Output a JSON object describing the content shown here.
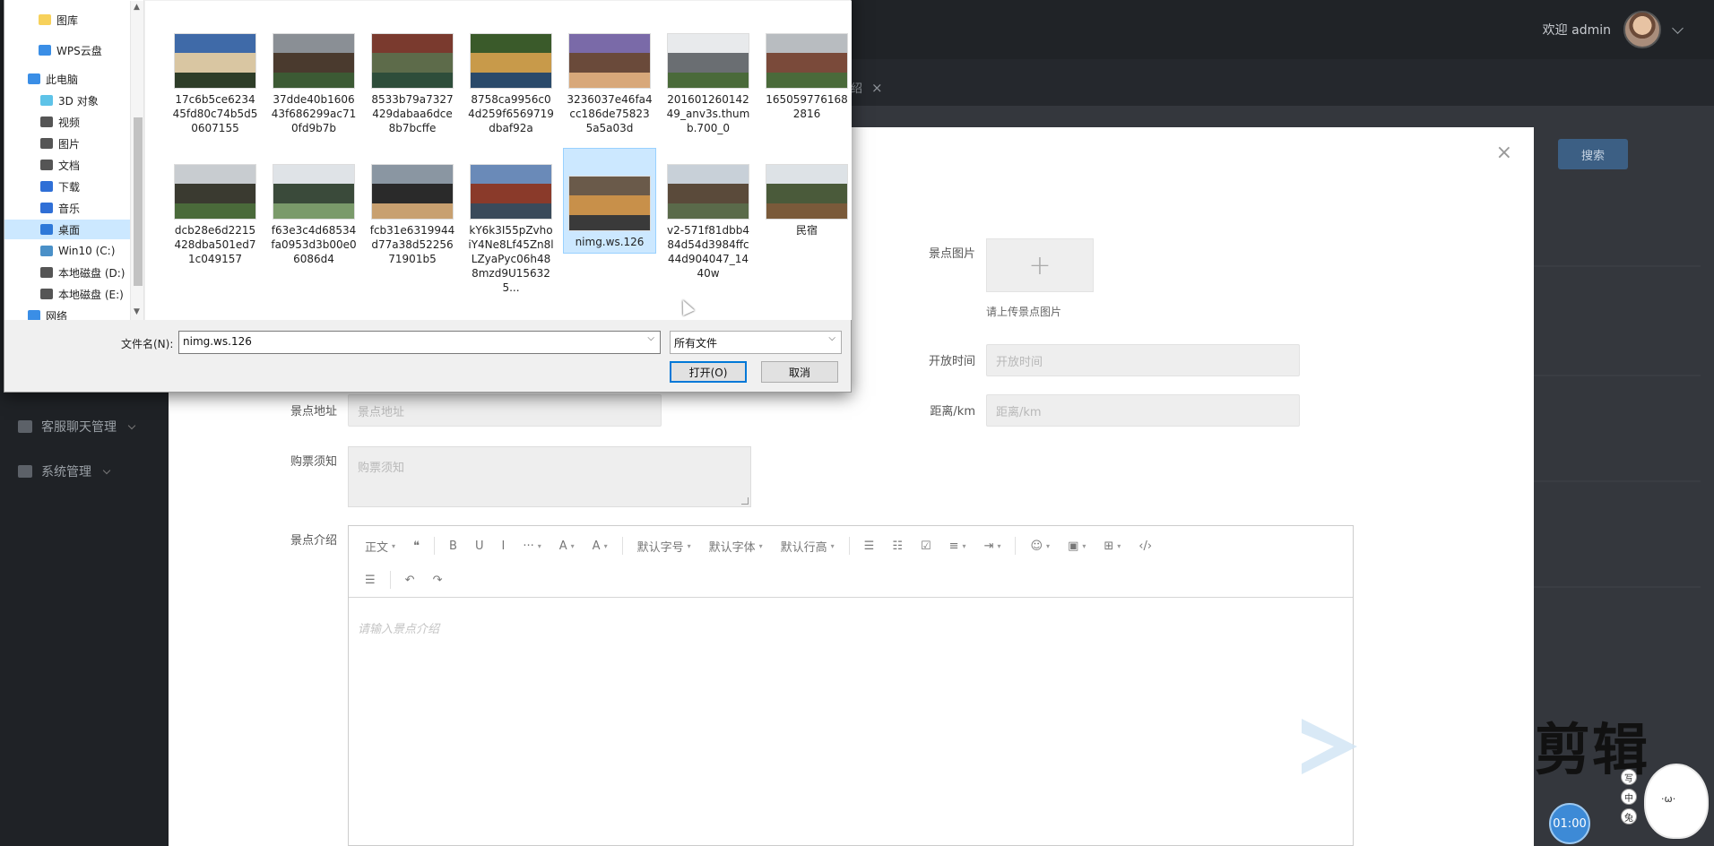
{
  "app": {
    "header": {
      "welcome": "欢迎 admin"
    },
    "tab": {
      "label": "介绍"
    },
    "sidebar": [
      {
        "label": "客服聊天管理"
      },
      {
        "label": "系统管理"
      }
    ],
    "search_button": "搜索"
  },
  "form": {
    "close": "×",
    "image_label": "景点图片",
    "upload_plus": "+",
    "upload_tip": "请上传景点图片",
    "open_time_label": "开放时间",
    "open_time_placeholder": "开放时间",
    "address_label": "景点地址",
    "address_placeholder": "景点地址",
    "distance_label": "距离/km",
    "distance_placeholder": "距离/km",
    "ticket_label": "购票须知",
    "ticket_placeholder": "购票须知",
    "intro_label": "景点介绍",
    "editor": {
      "toolbar_row1": [
        "正文",
        "❝",
        "B",
        "U",
        "I",
        "···",
        "A",
        "A",
        "默认字号",
        "默认字体",
        "默认行高",
        "☰",
        "☷",
        "☑",
        "≡",
        "⇥",
        "☺",
        "▣",
        "⊞",
        "‹/›"
      ],
      "toolbar_row2": [
        "☰",
        "↶",
        "↷"
      ],
      "placeholder": "请输入景点介绍"
    },
    "watermark": "剪辑"
  },
  "overlay": {
    "timer": "01:00",
    "mascot_face": "·ω·",
    "side_tools": [
      "写",
      "中",
      "兔"
    ]
  },
  "dialog": {
    "nav": [
      {
        "label": "图库",
        "icon": "folder-icon",
        "color": "#f7d15b"
      },
      {
        "label": "WPS云盘",
        "icon": "cloud-icon",
        "color": "#3a8ee6"
      },
      {
        "label": "此电脑",
        "icon": "computer-icon",
        "color": "#3a8ee6"
      },
      {
        "label": "3D 对象",
        "icon": "3d-icon",
        "color": "#5ec3e8"
      },
      {
        "label": "视频",
        "icon": "video-icon",
        "color": "#555555"
      },
      {
        "label": "图片",
        "icon": "pictures-icon",
        "color": "#555555"
      },
      {
        "label": "文档",
        "icon": "documents-icon",
        "color": "#555555"
      },
      {
        "label": "下载",
        "icon": "download-icon",
        "color": "#2f6fd6"
      },
      {
        "label": "音乐",
        "icon": "music-icon",
        "color": "#2f6fd6"
      },
      {
        "label": "桌面",
        "icon": "desktop-icon",
        "color": "#2f79d9"
      },
      {
        "label": "Win10 (C:)",
        "icon": "drive-icon",
        "color": "#4a90c8"
      },
      {
        "label": "本地磁盘 (D:)",
        "icon": "drive-icon",
        "color": "#555555"
      },
      {
        "label": "本地磁盘 (E:)",
        "icon": "drive-icon",
        "color": "#555555"
      },
      {
        "label": "网络",
        "icon": "network-icon",
        "color": "#3a8ee6"
      }
    ],
    "files": [
      {
        "name": "17c6b5ce623445fd80c74b5d50607155",
        "colors": [
          "#3f6aa8",
          "#d9c6a2",
          "#2e3d28"
        ]
      },
      {
        "name": "37dde40b160643f686299ac710fd9b7b",
        "colors": [
          "#8a8f95",
          "#4a3a2e",
          "#3c5a34"
        ]
      },
      {
        "name": "8533b79a7327429dabaa6dce8b7bcffe",
        "colors": [
          "#7a3a2e",
          "#5d6b4a",
          "#2e4d3a"
        ]
      },
      {
        "name": "8758ca9956c04d259f6569719dbaf92a",
        "colors": [
          "#3a5a2a",
          "#c89a4a",
          "#2a4a6a"
        ]
      },
      {
        "name": "3236037e46fa4cc186de758235a5a03d",
        "colors": [
          "#7a6aa8",
          "#6a4a3a",
          "#d8a87a"
        ]
      },
      {
        "name": "20160126014249_anv3s.thumb.700_0",
        "colors": [
          "#e8eaec",
          "#6a6e72",
          "#4a6a3a"
        ]
      },
      {
        "name": "1650597761682816",
        "colors": [
          "#b8bcc0",
          "#7a4a3a",
          "#4a6a3a"
        ]
      },
      {
        "name": "dcb28e6d2215428dba501ed71c049157",
        "colors": [
          "#c8ccd0",
          "#3a3a30",
          "#4a6a3a"
        ]
      },
      {
        "name": "f63e3c4d68534fa0953d3b00e06086d4",
        "colors": [
          "#dfe3e7",
          "#3a4a3a",
          "#7a9a6a"
        ]
      },
      {
        "name": "fcb31e6319944d77a38d5225671901b5",
        "colors": [
          "#8a96a2",
          "#2a2a2a",
          "#c8a070"
        ]
      },
      {
        "name": "kY6k3I55pZvhoiY4Ne8Lf45Zn8lLZyaPyc06h488mzd9U156325...",
        "colors": [
          "#6a8ab8",
          "#8a3a2a",
          "#3a4a5a"
        ]
      },
      {
        "name": "nimg.ws.126",
        "colors": [
          "#6a5a4a",
          "#c8904a",
          "#3a3a3a"
        ]
      },
      {
        "name": "v2-571f81dbb484d54d3984ffc44d904047_1440w",
        "colors": [
          "#c8d0d8",
          "#5a4a3a",
          "#5a6a4a"
        ]
      },
      {
        "name": "民宿",
        "colors": [
          "#dde2e6",
          "#4a5a3a",
          "#7a5a3a"
        ]
      }
    ],
    "filename_label": "文件名(N):",
    "filename_value": "nimg.ws.126",
    "filter_value": "所有文件",
    "open_button": "打开(O)",
    "cancel_button": "取消"
  }
}
